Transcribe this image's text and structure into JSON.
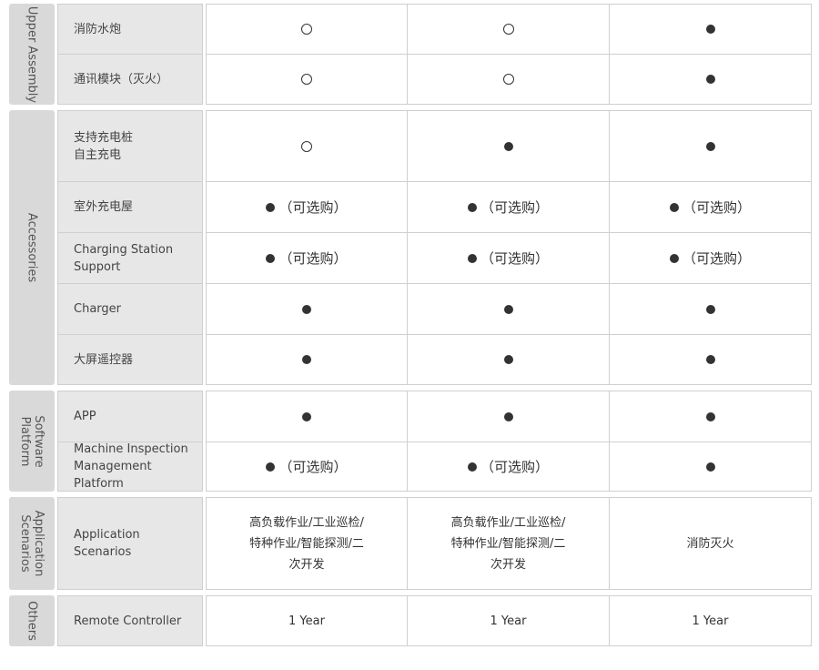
{
  "groups": {
    "upper_assembly": "Upper Assembly",
    "accessories": "Accessories",
    "software_platform": "Software\nPlatform",
    "application_scenarios": "Application\nScenarios",
    "others": "Others"
  },
  "symbols": {
    "included": "filled-dot",
    "not_included": "hollow-circle",
    "optional_label": "（可选购）"
  },
  "rows": [
    {
      "feature": "消防水炮",
      "values": [
        "not_included",
        "not_included",
        "included"
      ]
    },
    {
      "feature": "通讯模块（灭火）",
      "values": [
        "not_included",
        "not_included",
        "included"
      ]
    },
    {
      "feature": "支持充电桩\n自主充电",
      "values": [
        "not_included",
        "included",
        "included"
      ]
    },
    {
      "feature": "室外充电屋",
      "values": [
        "optional",
        "optional",
        "optional"
      ]
    },
    {
      "feature": "Charging Station\nSupport",
      "values": [
        "optional",
        "optional",
        "optional"
      ]
    },
    {
      "feature": "Charger",
      "values": [
        "included",
        "included",
        "included"
      ]
    },
    {
      "feature": "大屏遥控器",
      "values": [
        "included",
        "included",
        "included"
      ]
    },
    {
      "feature": "APP",
      "values": [
        "included",
        "included",
        "included"
      ]
    },
    {
      "feature": "Machine Inspection\nManagement Platform",
      "values": [
        "optional",
        "optional",
        "included"
      ]
    },
    {
      "feature": "Application\nScenarios",
      "values": [
        "高负载作业/工业巡检/\n特种作业/智能探测/二\n次开发",
        "高负载作业/工业巡检/\n特种作业/智能探测/二\n次开发",
        "消防灭火"
      ]
    },
    {
      "feature": "Remote Controller",
      "values": [
        "1 Year",
        "1 Year",
        "1 Year"
      ]
    }
  ]
}
